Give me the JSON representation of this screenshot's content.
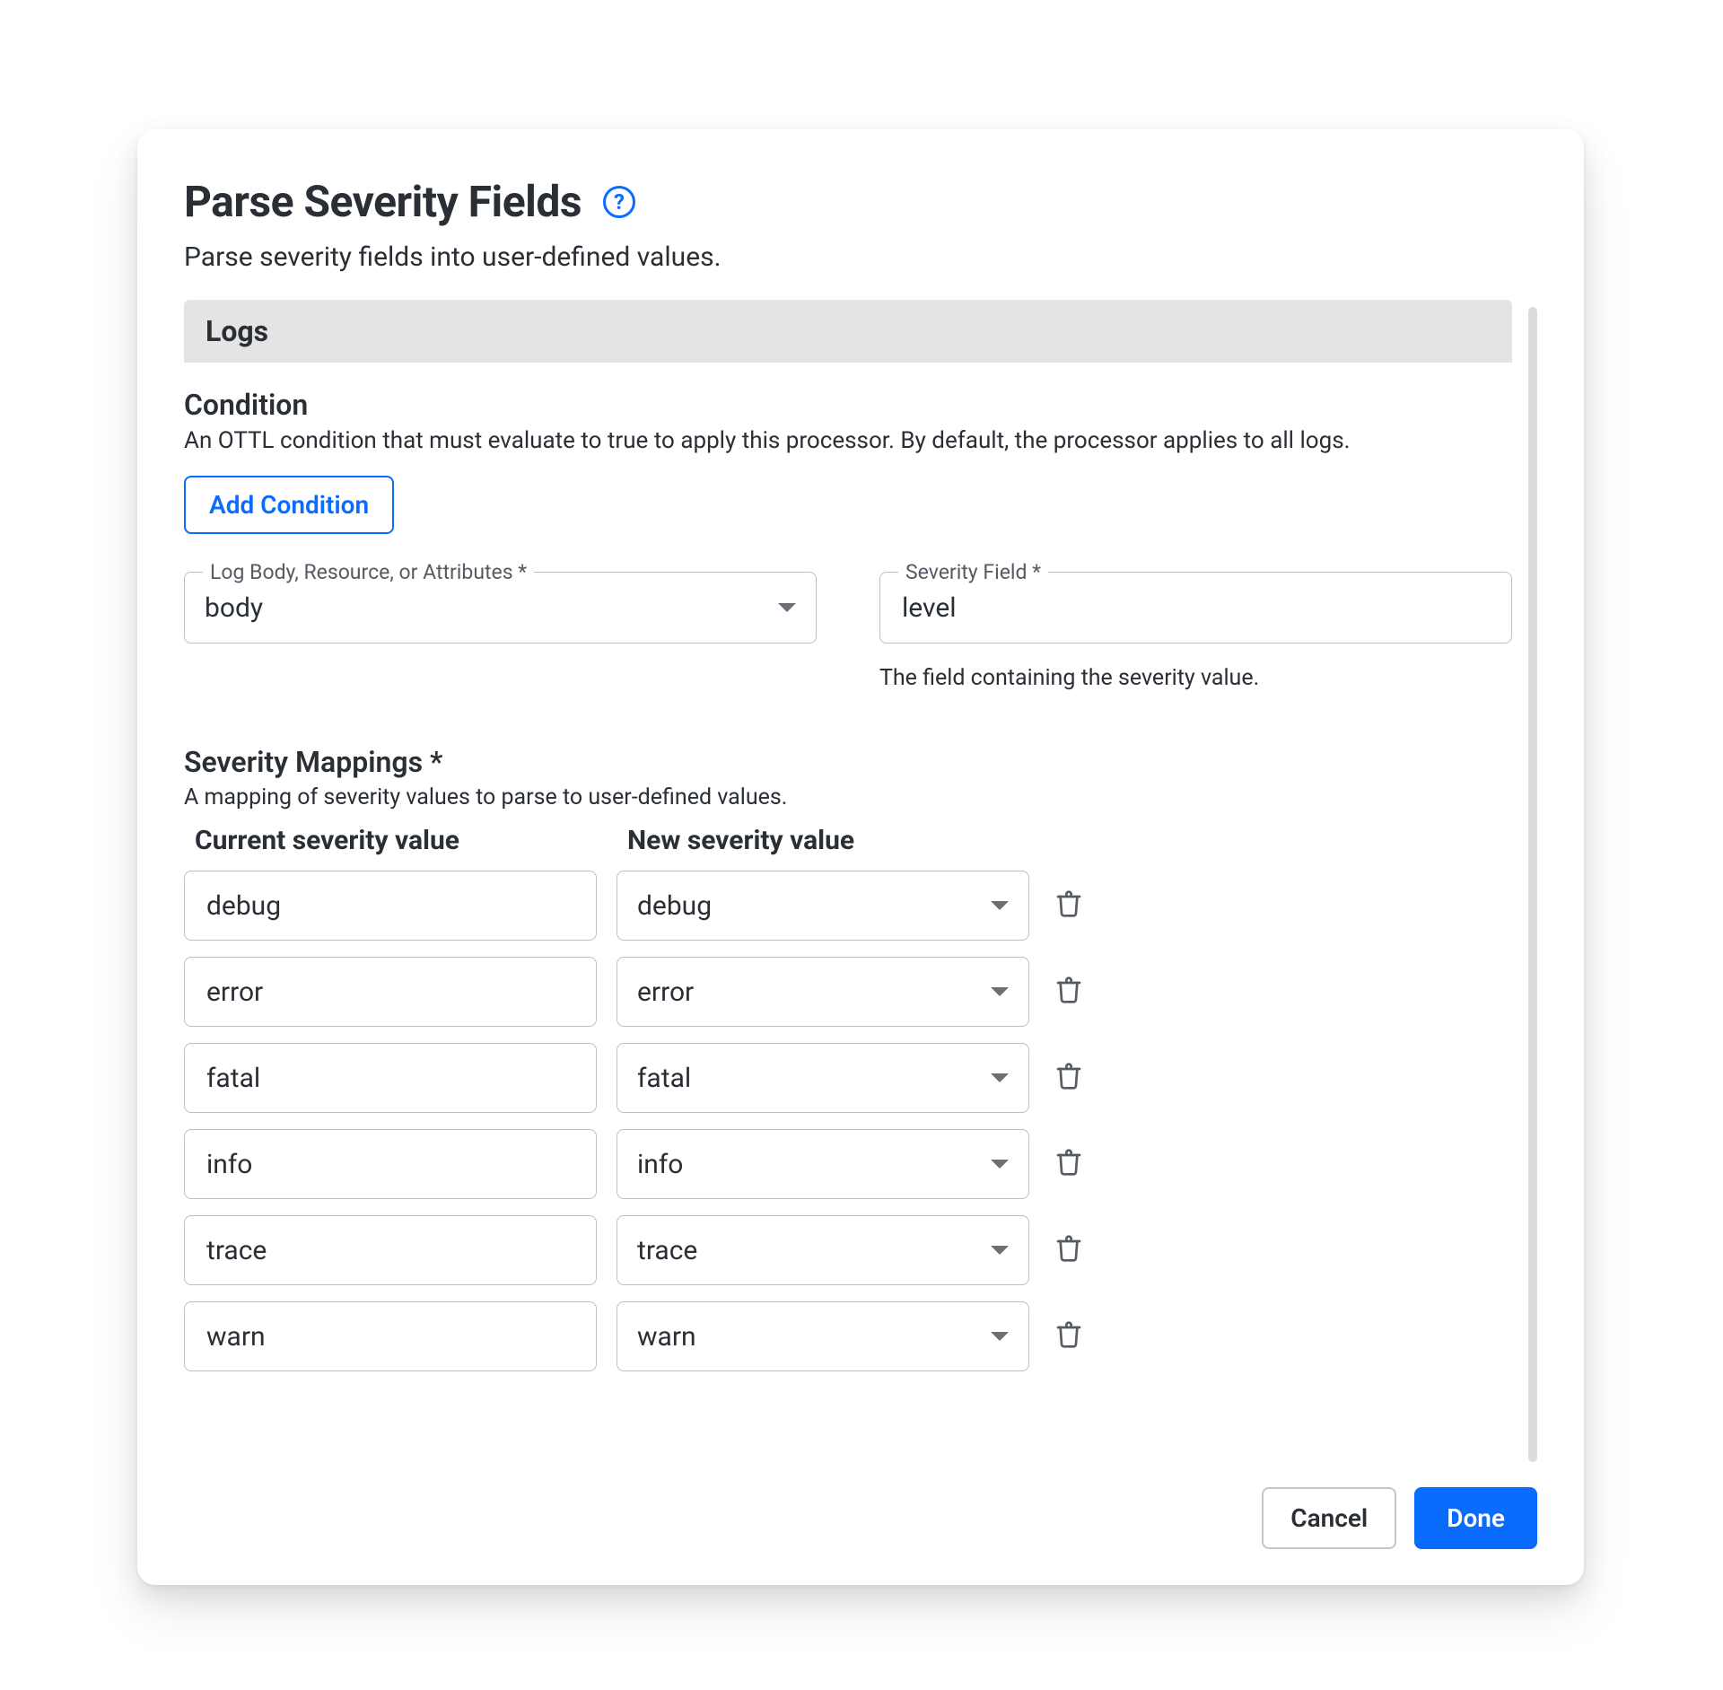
{
  "header": {
    "title": "Parse Severity Fields",
    "subtitle": "Parse severity fields into user-defined values."
  },
  "tabs": [
    {
      "label": "Logs"
    }
  ],
  "condition": {
    "title": "Condition",
    "description": "An OTTL condition that must evaluate to true to apply this processor. By default, the processor applies to all logs.",
    "add_button": "Add Condition"
  },
  "fields": {
    "source": {
      "label": "Log Body, Resource, or Attributes *",
      "value": "body"
    },
    "severity_field": {
      "label": "Severity Field *",
      "value": "level",
      "helper": "The field containing the severity value."
    }
  },
  "mappings": {
    "title": "Severity Mappings *",
    "description": "A mapping of severity values to parse to user-defined values.",
    "columns": {
      "current": "Current severity value",
      "new": "New severity value"
    },
    "rows": [
      {
        "current": "debug",
        "new": "debug"
      },
      {
        "current": "error",
        "new": "error"
      },
      {
        "current": "fatal",
        "new": "fatal"
      },
      {
        "current": "info",
        "new": "info"
      },
      {
        "current": "trace",
        "new": "trace"
      },
      {
        "current": "warn",
        "new": "warn"
      }
    ]
  },
  "footer": {
    "cancel": "Cancel",
    "done": "Done"
  }
}
